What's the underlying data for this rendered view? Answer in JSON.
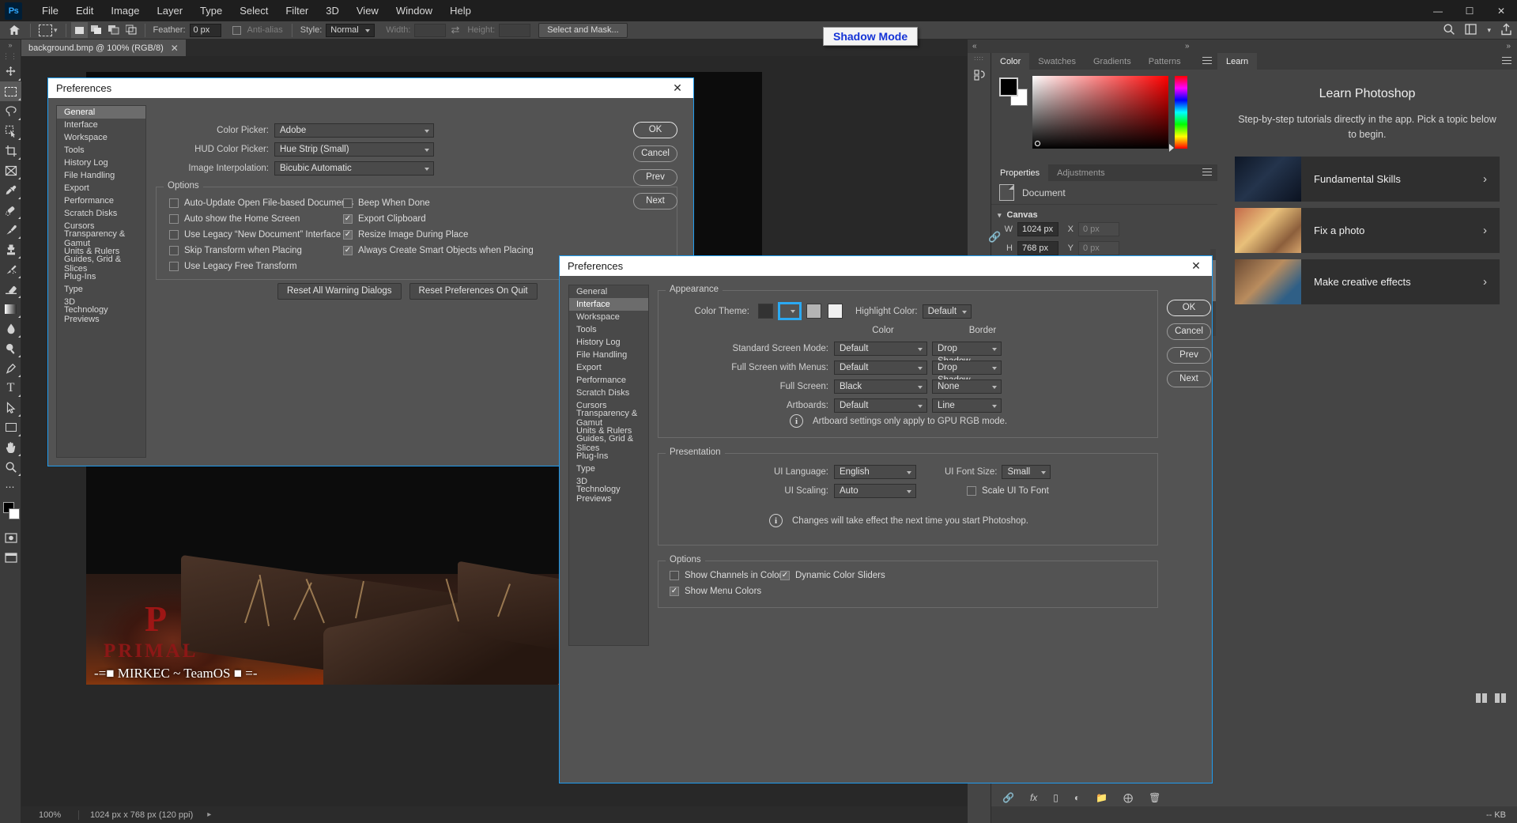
{
  "app": {
    "logo": "Ps",
    "menus": [
      "File",
      "Edit",
      "Image",
      "Layer",
      "Type",
      "Select",
      "Filter",
      "3D",
      "View",
      "Window",
      "Help"
    ],
    "window_controls": [
      "minimize",
      "maximize",
      "close"
    ]
  },
  "options_bar": {
    "home_icon": "home-icon",
    "tool_icon": "rectangular-marquee-icon",
    "selection_modes": [
      "new-selection",
      "add-to-selection",
      "subtract-from-selection",
      "intersect-with-selection"
    ],
    "feather_label": "Feather:",
    "feather_value": "0 px",
    "antialias_label": "Anti-alias",
    "style_label": "Style:",
    "style_value": "Normal",
    "width_label": "Width:",
    "width_value": "",
    "height_label": "Height:",
    "height_value": "",
    "select_and_mask": "Select and Mask..."
  },
  "toolbar": {
    "tools": [
      "move-tool",
      "rectangular-marquee-tool",
      "lasso-tool",
      "object-selection-tool",
      "crop-tool",
      "frame-tool",
      "eyedropper-tool",
      "spot-healing-brush-tool",
      "brush-tool",
      "clone-stamp-tool",
      "history-brush-tool",
      "eraser-tool",
      "gradient-tool",
      "blur-tool",
      "dodge-tool",
      "pen-tool",
      "type-tool",
      "path-selection-tool",
      "rectangle-tool",
      "hand-tool",
      "zoom-tool",
      "more-tools"
    ],
    "foreground_color": "#000000",
    "background_color": "#ffffff"
  },
  "document": {
    "tab_title": "background.bmp @ 100% (RGB/8)",
    "close_icon": "close-icon",
    "watermark_brand": "PRIMAL",
    "watermark_team": "-=■ MIRKEC ~ TeamOS ■ =-",
    "watermark_letter": "P"
  },
  "status_bar": {
    "zoom": "100%",
    "dimensions": "1024 px x 768 px (120 ppi)",
    "arrow_icon": "chevron-right-icon"
  },
  "tooltip": {
    "text": "Shadow Mode"
  },
  "color_panel": {
    "tabs": [
      "Color",
      "Swatches",
      "Gradients",
      "Patterns"
    ],
    "active_tab": "Color",
    "menu_icon": "panel-menu-icon",
    "foreground": "#000000",
    "background": "#ffffff"
  },
  "properties_panel": {
    "tabs": [
      "Properties",
      "Adjustments"
    ],
    "active_tab": "Properties",
    "menu_icon": "panel-menu-icon",
    "document_label": "Document",
    "document_icon": "document-icon",
    "canvas_section": "Canvas",
    "link_icon": "link-icon",
    "w_label": "W",
    "w_value": "1024 px",
    "h_label": "H",
    "h_value": "768 px",
    "x_label": "X",
    "x_value": "0 px",
    "y_label": "Y",
    "y_value": "0 px",
    "orientation": [
      "portrait-icon",
      "landscape-icon"
    ],
    "orientation_active": "landscape-icon"
  },
  "learn_panel": {
    "tab": "Learn",
    "menu_icon": "panel-menu-icon",
    "title": "Learn Photoshop",
    "subtitle": "Step-by-step tutorials directly in the app. Pick a topic below to begin.",
    "cards": [
      {
        "label": "Fundamental Skills",
        "arrow": "chevron-right-icon"
      },
      {
        "label": "Fix a photo",
        "arrow": "chevron-right-icon"
      },
      {
        "label": "Make creative effects",
        "arrow": "chevron-right-icon"
      }
    ]
  },
  "dock_bottom": {
    "icons": [
      "link-layers-icon",
      "fx-icon",
      "layer-mask-icon",
      "adjustment-icon",
      "new-group-icon",
      "new-layer-icon",
      "delete-layer-icon"
    ],
    "size_label": "-- KB"
  },
  "header_icons": {
    "search": "search-icon",
    "workspace": "workspace-icon",
    "chevron": "chevron-down-icon",
    "share": "share-icon"
  },
  "dialog_general": {
    "title": "Preferences",
    "close_icon": "close-icon",
    "nav_items": [
      "General",
      "Interface",
      "Workspace",
      "Tools",
      "History Log",
      "File Handling",
      "Export",
      "Performance",
      "Scratch Disks",
      "Cursors",
      "Transparency & Gamut",
      "Units & Rulers",
      "Guides, Grid & Slices",
      "Plug-Ins",
      "Type",
      "3D",
      "Technology Previews"
    ],
    "nav_active": "General",
    "fields": [
      {
        "label": "Color Picker:",
        "value": "Adobe"
      },
      {
        "label": "HUD Color Picker:",
        "value": "Hue Strip (Small)"
      },
      {
        "label": "Image Interpolation:",
        "value": "Bicubic Automatic"
      }
    ],
    "options_group_label": "Options",
    "options_left": [
      {
        "label": "Auto-Update Open File-based Documents",
        "checked": false
      },
      {
        "label": "Auto show the Home Screen",
        "checked": false
      },
      {
        "label": "Use Legacy “New Document” Interface",
        "checked": false
      },
      {
        "label": "Skip Transform when Placing",
        "checked": false
      },
      {
        "label": "Use Legacy Free Transform",
        "checked": false
      }
    ],
    "options_right": [
      {
        "label": "Beep When Done",
        "checked": false
      },
      {
        "label": "Export Clipboard",
        "checked": true
      },
      {
        "label": "Resize Image During Place",
        "checked": true
      },
      {
        "label": "Always Create Smart Objects when Placing",
        "checked": true
      }
    ],
    "reset_buttons": [
      "Reset All Warning Dialogs",
      "Reset Preferences On Quit"
    ],
    "action_buttons": [
      "OK",
      "Cancel",
      "Prev",
      "Next"
    ]
  },
  "dialog_interface": {
    "title": "Preferences",
    "close_icon": "close-icon",
    "nav_items": [
      "General",
      "Interface",
      "Workspace",
      "Tools",
      "History Log",
      "File Handling",
      "Export",
      "Performance",
      "Scratch Disks",
      "Cursors",
      "Transparency & Gamut",
      "Units & Rulers",
      "Guides, Grid & Slices",
      "Plug-Ins",
      "Type",
      "3D",
      "Technology Previews"
    ],
    "nav_active": "Interface",
    "appearance_label": "Appearance",
    "color_theme_label": "Color Theme:",
    "color_theme_swatches": [
      "#323232",
      "#535353",
      "#b4b4b4",
      "#f0f0f0"
    ],
    "color_theme_selected_index": 1,
    "highlight_color_label": "Highlight Color:",
    "highlight_color_value": "Default",
    "col_header_color": "Color",
    "col_header_border": "Border",
    "screen_rows": [
      {
        "label": "Standard Screen Mode:",
        "color": "Default",
        "border": "Drop Shadow"
      },
      {
        "label": "Full Screen with Menus:",
        "color": "Default",
        "border": "Drop Shadow"
      },
      {
        "label": "Full Screen:",
        "color": "Black",
        "border": "None"
      },
      {
        "label": "Artboards:",
        "color": "Default",
        "border": "Line"
      }
    ],
    "appearance_note": "Artboard settings only apply to GPU RGB mode.",
    "presentation_label": "Presentation",
    "ui_language_label": "UI Language:",
    "ui_language_value": "English",
    "ui_font_size_label": "UI Font Size:",
    "ui_font_size_value": "Small",
    "ui_scaling_label": "UI Scaling:",
    "ui_scaling_value": "Auto",
    "scale_ui_label": "Scale UI To Font",
    "scale_ui_checked": false,
    "presentation_note": "Changes will take effect the next time you start Photoshop.",
    "options_label": "Options",
    "options": [
      {
        "label": "Show Channels in Color",
        "checked": false
      },
      {
        "label": "Dynamic Color Sliders",
        "checked": true
      },
      {
        "label": "Show Menu Colors",
        "checked": true
      }
    ],
    "action_buttons": [
      "OK",
      "Cancel",
      "Prev",
      "Next"
    ]
  }
}
